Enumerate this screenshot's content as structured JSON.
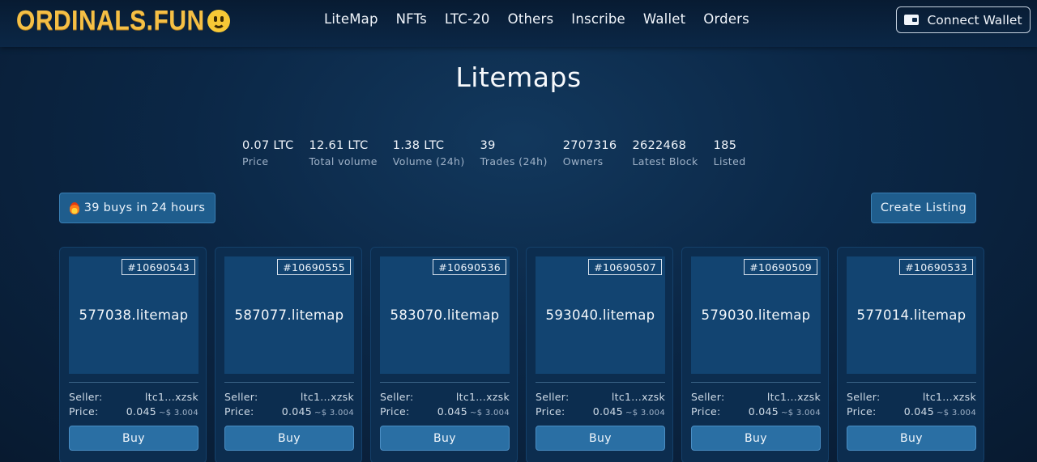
{
  "header": {
    "logo_text": "ORDINALS.FUN",
    "nav": [
      "LiteMap",
      "NFTs",
      "LTC-20",
      "Others",
      "Inscribe",
      "Wallet",
      "Orders"
    ],
    "connect_label": "Connect Wallet"
  },
  "page": {
    "title": "Litemaps"
  },
  "stats": [
    {
      "value": "0.07 LTC",
      "label": "Price"
    },
    {
      "value": "12.61 LTC",
      "label": "Total volume"
    },
    {
      "value": "1.38 LTC",
      "label": "Volume (24h)"
    },
    {
      "value": "39",
      "label": "Trades (24h)"
    },
    {
      "value": "2707316",
      "label": "Owners"
    },
    {
      "value": "2622468",
      "label": "Latest Block"
    },
    {
      "value": "185",
      "label": "Listed"
    }
  ],
  "actions": {
    "buys_label": "39 buys in 24 hours",
    "create_label": "Create Listing"
  },
  "card_labels": {
    "seller": "Seller:",
    "price": "Price:",
    "buy": "Buy"
  },
  "cards": [
    {
      "id": "#10690543",
      "name": "577038.litemap",
      "seller": "ltc1...xzsk",
      "price": "0.045",
      "usd": "~$ 3.004"
    },
    {
      "id": "#10690555",
      "name": "587077.litemap",
      "seller": "ltc1...xzsk",
      "price": "0.045",
      "usd": "~$ 3.004"
    },
    {
      "id": "#10690536",
      "name": "583070.litemap",
      "seller": "ltc1...xzsk",
      "price": "0.045",
      "usd": "~$ 3.004"
    },
    {
      "id": "#10690507",
      "name": "593040.litemap",
      "seller": "ltc1...xzsk",
      "price": "0.045",
      "usd": "~$ 3.004"
    },
    {
      "id": "#10690509",
      "name": "579030.litemap",
      "seller": "ltc1...xzsk",
      "price": "0.045",
      "usd": "~$ 3.004"
    },
    {
      "id": "#10690533",
      "name": "577014.litemap",
      "seller": "ltc1...xzsk",
      "price": "0.045",
      "usd": "~$ 3.004"
    }
  ],
  "colors": {
    "background": "#0b2746",
    "logo": "#f5bf45",
    "button": "#2a6fa4",
    "card": "#0c2d4f"
  },
  "icons": [
    "smiley-logo-icon",
    "wallet-icon",
    "fire-icon"
  ]
}
